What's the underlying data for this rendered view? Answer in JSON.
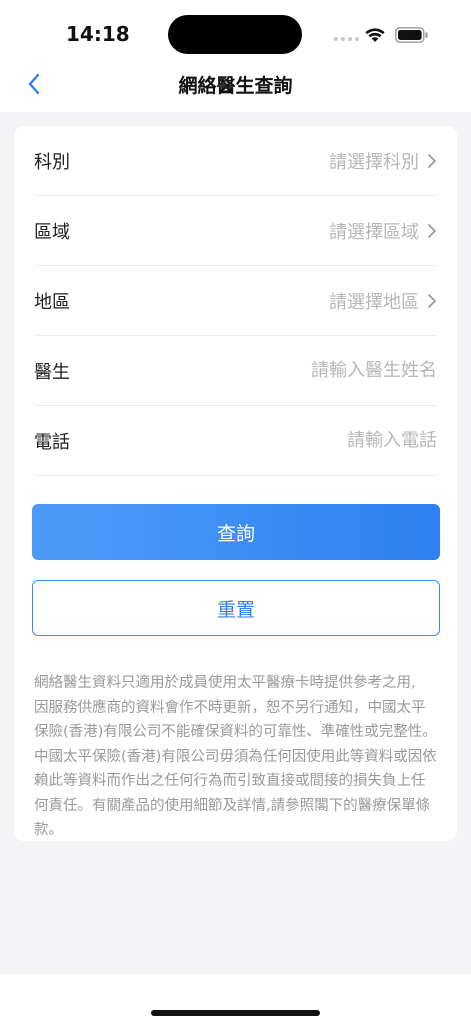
{
  "status": {
    "time": "14:18"
  },
  "nav": {
    "title": "網絡醫生查詢"
  },
  "form": {
    "rows": [
      {
        "label": "科別",
        "placeholder": "請選擇科別"
      },
      {
        "label": "區域",
        "placeholder": "請選擇區域"
      },
      {
        "label": "地區",
        "placeholder": "請選擇地區"
      },
      {
        "label": "醫生",
        "placeholder": "請輸入醫生姓名"
      },
      {
        "label": "電話",
        "placeholder": "請輸入電話"
      }
    ]
  },
  "buttons": {
    "search": "查詢",
    "reset": "重置"
  },
  "disclaimer": {
    "lines": [
      "網絡醫生資料只適用於成員使用太平醫療卡時提供參考之用,",
      "因服務供應商的資料會作不時更新，恕不另行通知，中國太平",
      "保險(香港)有限公司不能確保資料的可靠性、準確性或完整性。",
      "中國太平保險(香港)有限公司毋須為任何因使用此等資料或因依",
      "賴此等資料而作出之任何行為而引致直接或間接的損失負上任",
      "何責任。有關產品的使用細節及詳情,請參照閣下的醫療保單條",
      "款。"
    ]
  },
  "colors": {
    "accent": "#2f80f2",
    "accent_light": "#4d9bf7",
    "background": "#f4f4f6"
  },
  "icons": {
    "back": "chevron-left-icon",
    "select": "chevron-right-icon"
  }
}
